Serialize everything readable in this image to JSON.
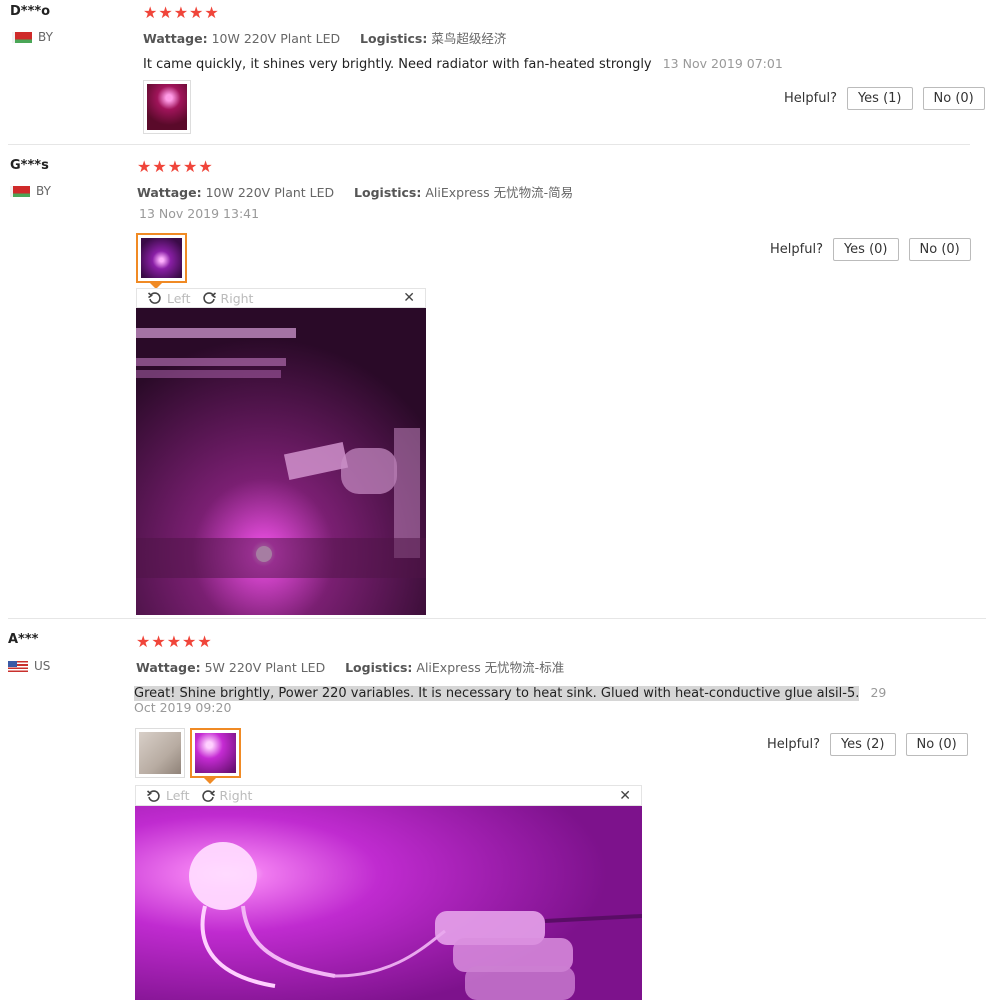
{
  "reviews": [
    {
      "user": "D***o",
      "country": "BY",
      "stars": "★★★★★",
      "wattage_label": "Wattage:",
      "wattage_value": "10W 220V Plant LED",
      "logistics_label": "Logistics:",
      "logistics_value": "菜鸟超级经济",
      "text": "It came quickly, it shines very brightly. Need radiator with fan-heated strongly",
      "date": "13 Nov 2019 07:01",
      "helpful_label": "Helpful?",
      "yes_label": "Yes (1)",
      "no_label": "No (0)"
    },
    {
      "user": "G***s",
      "country": "BY",
      "stars": "★★★★★",
      "wattage_label": "Wattage:",
      "wattage_value": "10W 220V Plant LED",
      "logistics_label": "Logistics:",
      "logistics_value": "AliExpress 无忧物流-简易",
      "date": "13 Nov 2019 13:41",
      "helpful_label": "Helpful?",
      "yes_label": "Yes (0)",
      "no_label": "No (0)",
      "viewer": {
        "left_label": "Left",
        "right_label": "Right",
        "close_label": "✕"
      }
    },
    {
      "user": "A***",
      "country": "US",
      "stars": "★★★★★",
      "wattage_label": "Wattage:",
      "wattage_value": "5W 220V Plant LED",
      "logistics_label": "Logistics:",
      "logistics_value": "AliExpress 无忧物流-标准",
      "text_highlighted": "Great! Shine brightly, Power 220 variables. It is necessary to heat sink. Glued with heat-conductive glue alsil-5.",
      "date_part1": "29",
      "date_part2": "Oct 2019 09:20",
      "helpful_label": "Helpful?",
      "yes_label": "Yes (2)",
      "no_label": "No (0)",
      "viewer": {
        "left_label": "Left",
        "right_label": "Right",
        "close_label": "✕"
      }
    }
  ],
  "colors": {
    "star": "#f0453a",
    "active_thumb": "#f08a24",
    "photo_magenta": "#c21fd0"
  }
}
